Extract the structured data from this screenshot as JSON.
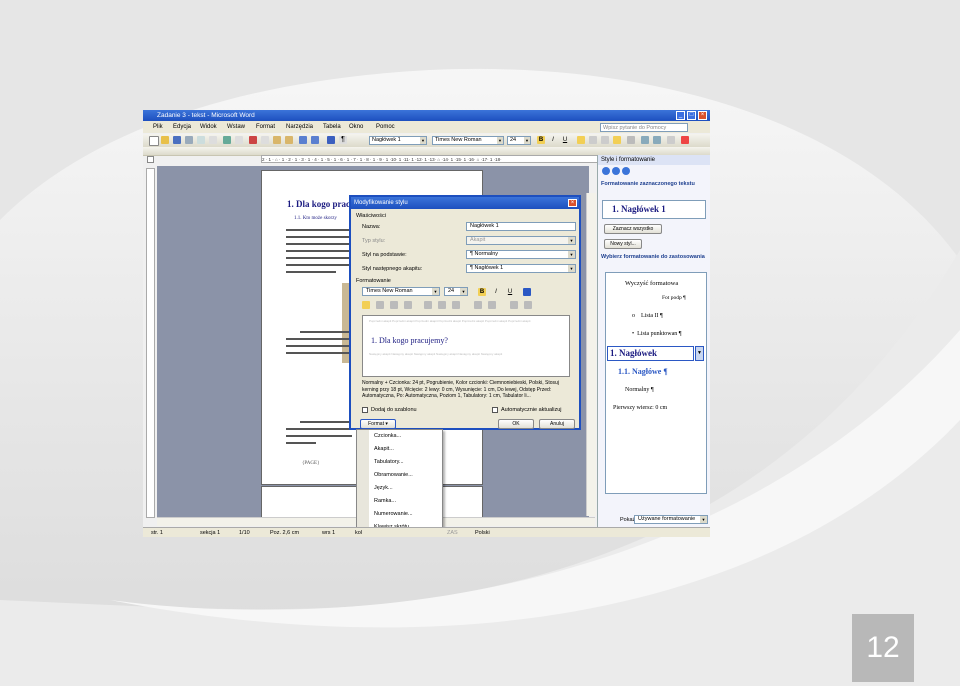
{
  "slide": {
    "page_number": "12"
  },
  "window": {
    "title": "Zadanie 3 - tekst - Microsoft Word"
  },
  "menu": {
    "items": [
      "Plik",
      "Edycja",
      "Widok",
      "Wstaw",
      "Format",
      "Narzędzia",
      "Tabela",
      "Okno",
      "Pomoc"
    ],
    "help_placeholder": "Wpisz pytanie do Pomocy"
  },
  "toolbar": {
    "style": "Nagłówek 1",
    "font": "Times New Roman",
    "size": "24"
  },
  "ruler": {
    "text": "2 · 1 · ⌂ · 1 · 2 · 1 · 3 · 1 · 4 · 1 · 5 · 1 · 6 · 1 · 7 · 1 · 8 · 1 · 9 · 1 ·10· 1 ·11· 1 ·12· 1 ·13· ⌂ ·14· 1 ·15· 1 ·16· ⌂ ·17· 1 ·18·"
  },
  "document": {
    "heading1": "1.  Dla kogo prac",
    "heading2": "1.1.  Kto może skorzy",
    "footer": "{PAGE}"
  },
  "dialog": {
    "title": "Modyfikowanie stylu",
    "properties_label": "Właściwości",
    "name_label": "Nazwa:",
    "name_value": "Nagłówek 1",
    "type_label": "Typ stylu:",
    "type_value": "Akapit",
    "based_label": "Styl na podstawie:",
    "based_value": "¶ Normalny",
    "next_label": "Styl następnego akapitu:",
    "next_value": "¶ Nagłówek 1",
    "formatting_label": "Formatowanie",
    "font_value": "Times New Roman",
    "size_value": "24",
    "preview_text": "1.  Dla kogo pracujemy?",
    "preview_prev": "Poprzedni akapit Poprzedni akapit Poprzedni akapit Poprzedni akapit Poprzedni akapit Poprzedni akapit Poprzedni akapit",
    "preview_next": "Następny akapit Następny akapit Następny akapit Następny akapit Następny akapit Następny akapit",
    "description": "Normalny + Czcionka: 24 pt, Pogrubienie, Kolor czcionki: Ciemnoniebieski, Polski, Stosuj kerning przy 18 pt, Wcięcie: 2 lewy: 0 cm, Wysunięcie: 1 cm, Do lewej, Odstęp Przed: Automatyczna, Po: Automatyczna, Poziom 1, Tabulatory: 1 cm, Tabulator li...",
    "add_template": "Dodaj do szablonu",
    "auto_update": "Automatycznie aktualizuj",
    "format_button": "Format ▾",
    "ok": "OK",
    "cancel": "Anuluj"
  },
  "format_menu": {
    "items": [
      "Czcionka...",
      "Akapit...",
      "Tabulatory...",
      "Obramowanie...",
      "Język...",
      "Ramka...",
      "Numerowanie...",
      "Klawisz skrótu..."
    ]
  },
  "taskpane": {
    "title": "Style i formatowanie",
    "selected_label": "Formatowanie zaznaczonego tekstu",
    "selected_value": "1.  Nagłówek 1",
    "select_all": "Zaznacz wszystko",
    "new_style": "Nowy styl...",
    "apply_label": "Wybierz formatowanie do zastosowania",
    "styles": [
      "Wyczyść formatowa",
      "Fot podp",
      "Lista II",
      "Lista punktowan",
      "1.  Nagłówek",
      "1.1.  Nagłówe",
      "Normalny",
      "Pierwszy wiersz:  0 cm"
    ],
    "show_label": "Pokaż:",
    "show_value": "Używane formatowanie"
  },
  "status": {
    "page": "str. 1",
    "section": "sekcja 1",
    "pages": "1/10",
    "pos": "Poz. 2,6 cm",
    "line": "wrs 1",
    "col": "kol",
    "zas": "ZAS",
    "lang": "Polski"
  },
  "colors": {
    "title_bar": "#1d4fbf",
    "heading": "#1a1a80",
    "accent": "#2b58c4"
  }
}
